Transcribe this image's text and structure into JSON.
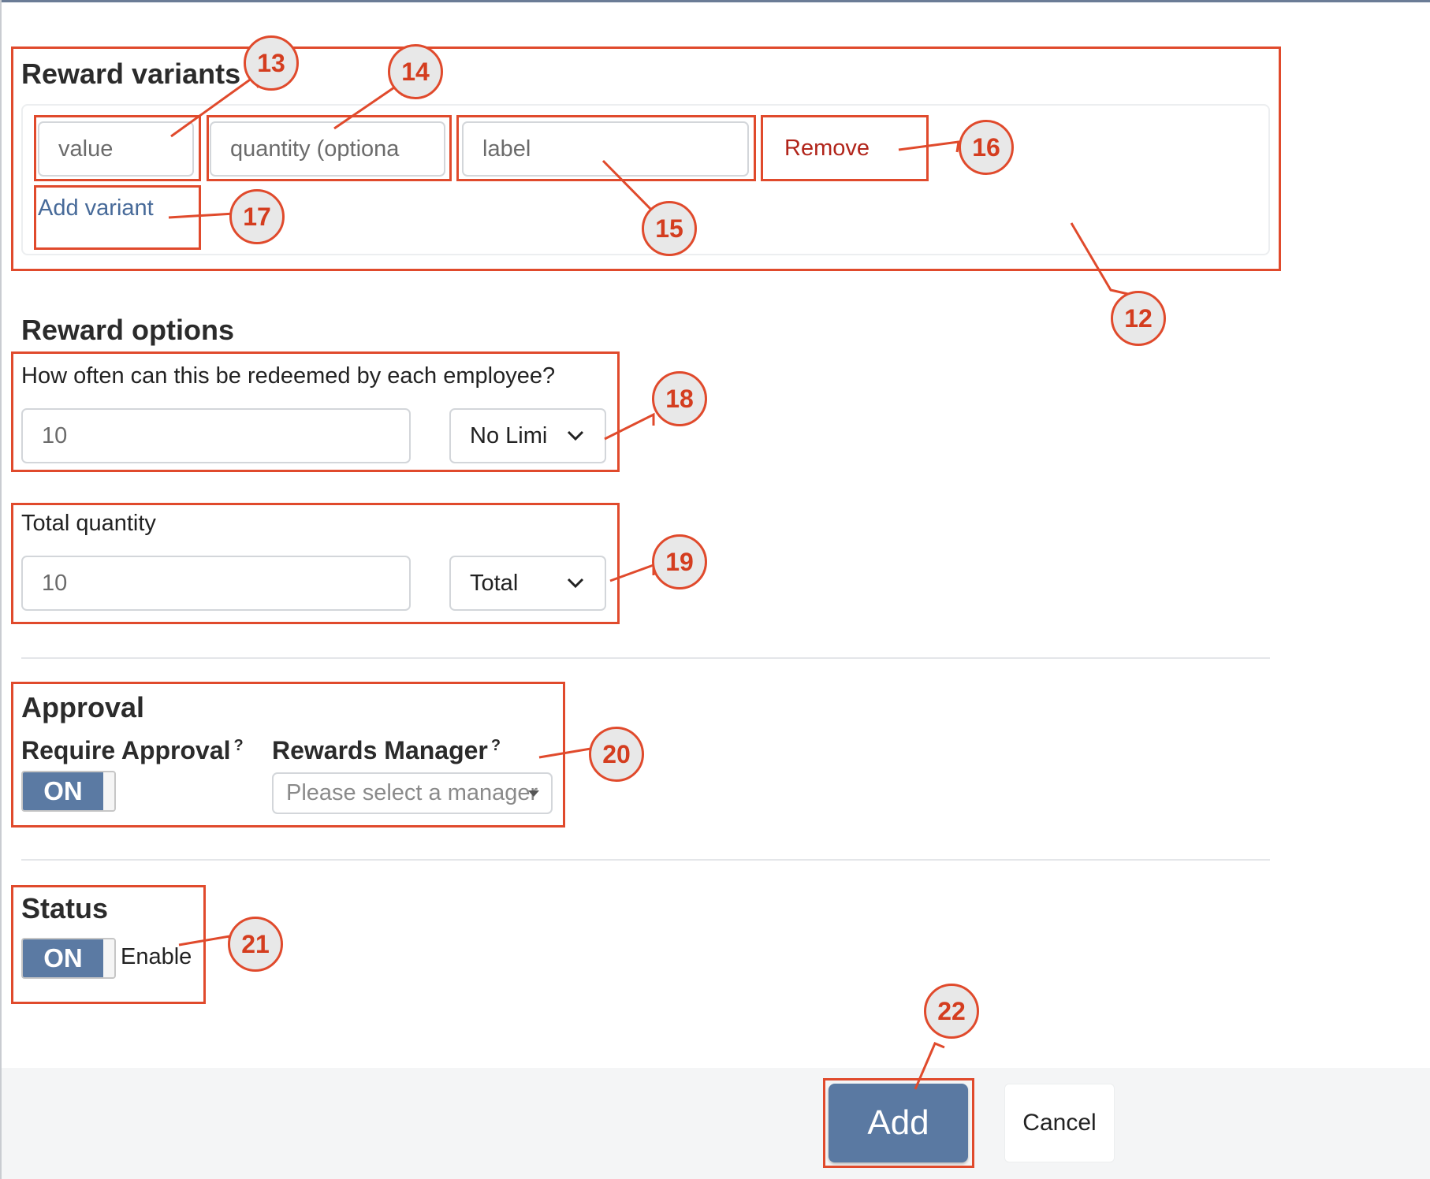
{
  "reward_variants": {
    "title": "Reward variants",
    "value_placeholder": "value",
    "quantity_placeholder": "quantity (optiona",
    "label_placeholder": "label",
    "remove_label": "Remove",
    "add_variant_label": "Add variant"
  },
  "reward_options": {
    "title": "Reward options",
    "redeem_question": "How often can this be redeemed by each employee?",
    "redeem_value": "10",
    "redeem_period": "No Limi",
    "total_label": "Total quantity",
    "total_value": "10",
    "total_period": "Total"
  },
  "approval": {
    "title": "Approval",
    "require_label": "Require Approval",
    "require_help": "?",
    "require_toggle": "ON",
    "manager_label": "Rewards Manager",
    "manager_help": "?",
    "manager_placeholder": "Please select a manager"
  },
  "status": {
    "title": "Status",
    "toggle": "ON",
    "enable_label": "Enable"
  },
  "footer": {
    "add_label": "Add",
    "cancel_label": "Cancel"
  },
  "annotations": {
    "n12": "12",
    "n13": "13",
    "n14": "14",
    "n15": "15",
    "n16": "16",
    "n17": "17",
    "n18": "18",
    "n19": "19",
    "n20": "20",
    "n21": "21",
    "n22": "22"
  },
  "colors": {
    "accent": "#5a79a2",
    "danger_text": "#b1241a",
    "link": "#476a99",
    "callout": "#e04a2c"
  }
}
